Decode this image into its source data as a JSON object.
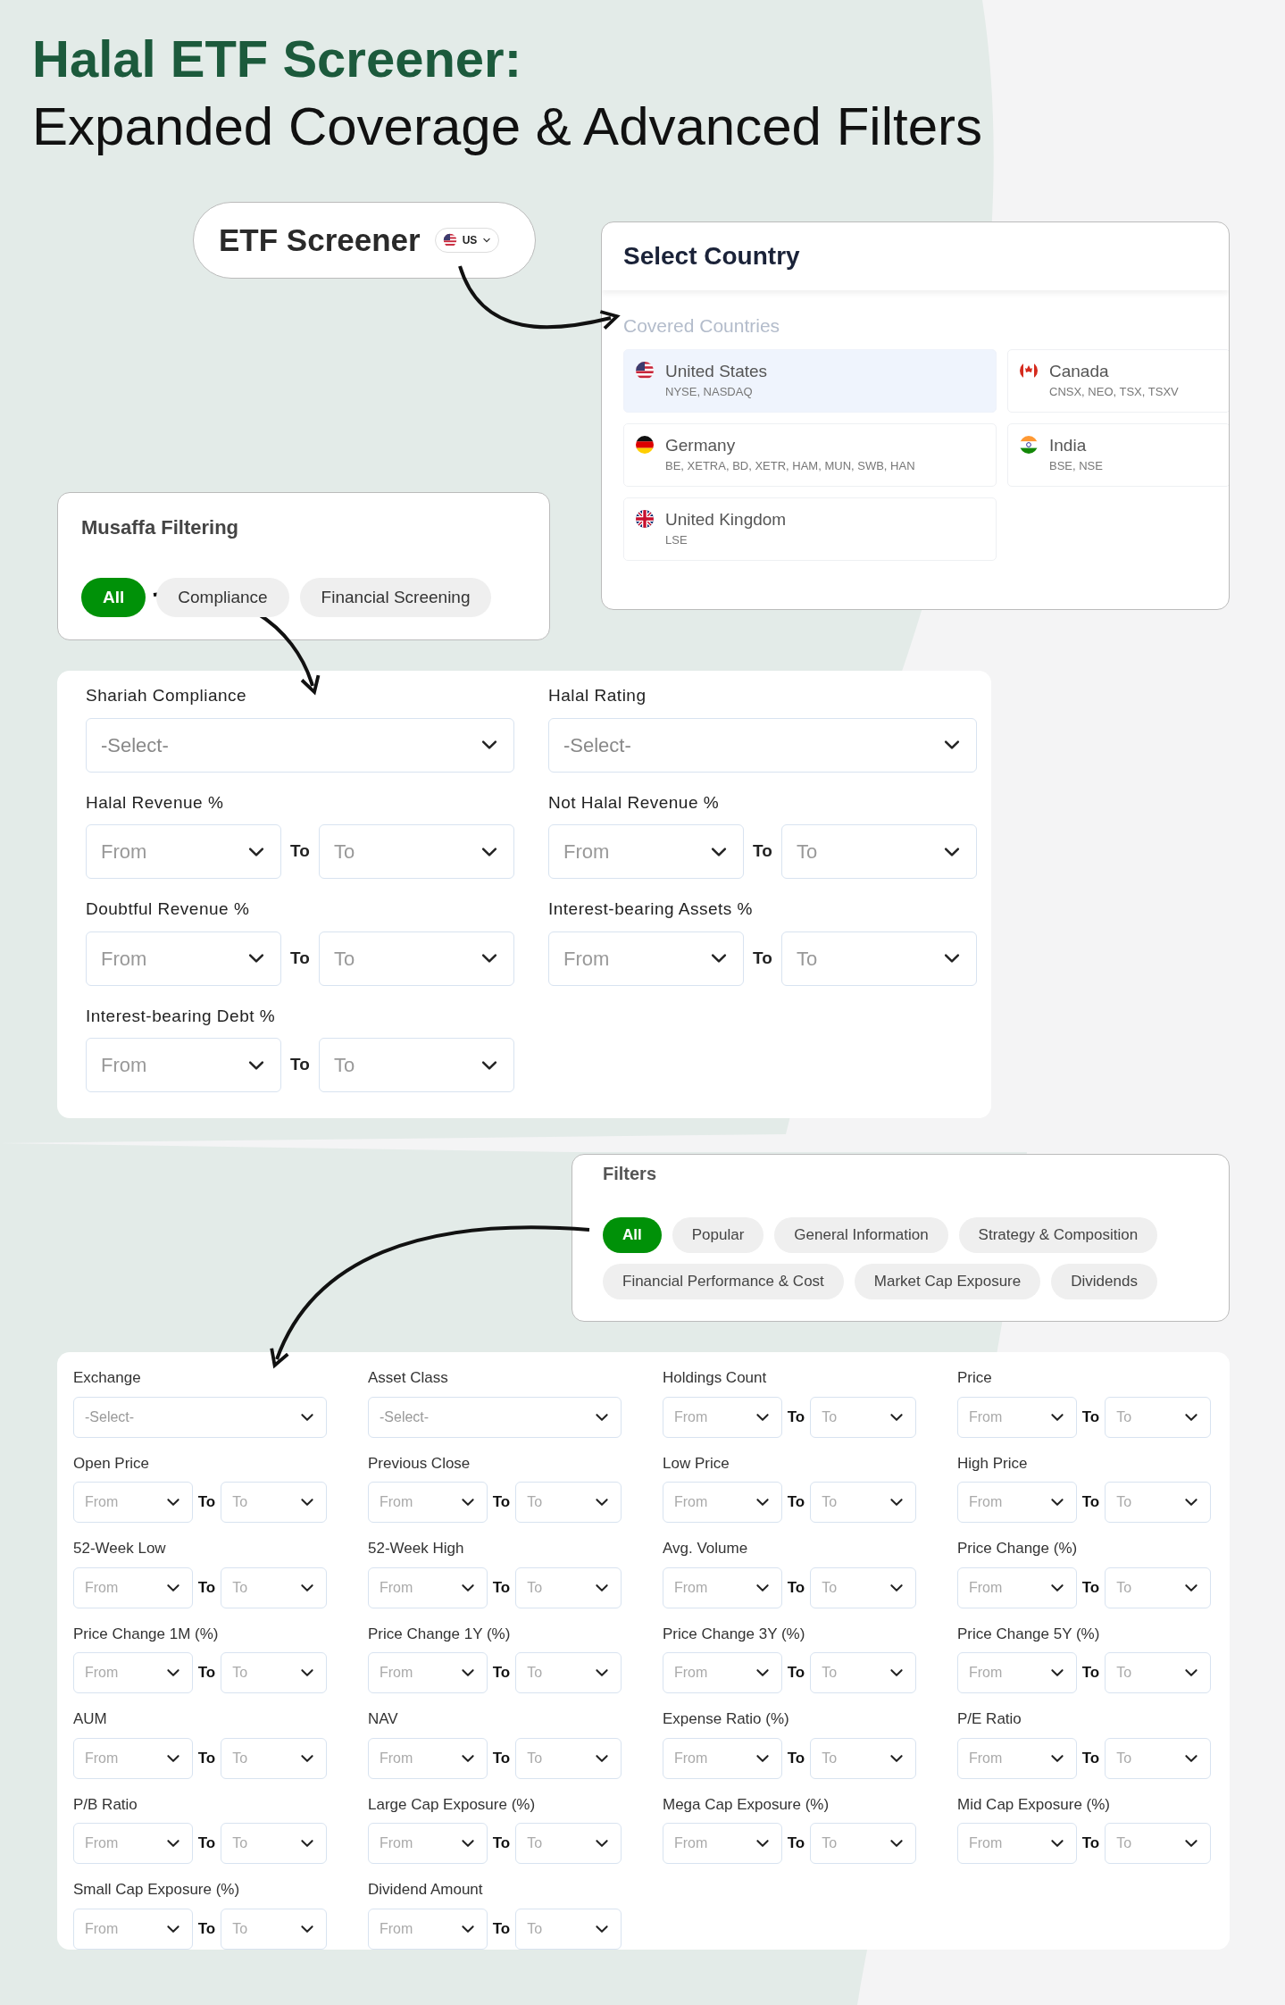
{
  "headline": {
    "title": "Halal ETF Screener:",
    "subtitle": "Expanded Coverage & Advanced Filters"
  },
  "etf_screener": {
    "title": "ETF Screener",
    "country_code": "US"
  },
  "select_country": {
    "title": "Select Country",
    "section": "Covered Countries",
    "countries": [
      {
        "name": "United States",
        "exchanges": "NYSE, NASDAQ",
        "kind": "us",
        "selected": true
      },
      {
        "name": "Canada",
        "exchanges": "CNSX, NEO, TSX, TSXV",
        "kind": "ca",
        "selected": false
      },
      {
        "name": "Germany",
        "exchanges": "BE, XETRA, BD, XETR, HAM, MUN, SWB, HAN",
        "kind": "de",
        "selected": false
      },
      {
        "name": "India",
        "exchanges": "BSE, NSE",
        "kind": "in",
        "selected": false
      },
      {
        "name": "United Kingdom",
        "exchanges": "LSE",
        "kind": "gb",
        "selected": false
      }
    ]
  },
  "musaffa_filtering": {
    "title": "Musaffa Filtering",
    "chips": [
      {
        "label": "All",
        "selected": true
      },
      {
        "label": "Compliance",
        "selected": false
      },
      {
        "label": "Financial Screening",
        "selected": false
      }
    ]
  },
  "shariah_filters": [
    {
      "label": "Shariah Compliance",
      "kind": "select",
      "placeholder": "-Select-"
    },
    {
      "label": "Halal Rating",
      "kind": "select",
      "placeholder": "-Select-"
    },
    {
      "label": "Halal Revenue %",
      "kind": "range",
      "from": "From",
      "separator": "To",
      "to": "To"
    },
    {
      "label": "Not Halal Revenue %",
      "kind": "range",
      "from": "From",
      "separator": "To",
      "to": "To"
    },
    {
      "label": "Doubtful Revenue %",
      "kind": "range",
      "from": "From",
      "separator": "To",
      "to": "To"
    },
    {
      "label": "Interest-bearing Assets %",
      "kind": "range",
      "from": "From",
      "separator": "To",
      "to": "To"
    },
    {
      "label": "Interest-bearing Debt %",
      "kind": "range",
      "from": "From",
      "separator": "To",
      "to": "To"
    }
  ],
  "filters": {
    "title": "Filters",
    "chips": [
      {
        "label": "All",
        "selected": true
      },
      {
        "label": "Popular",
        "selected": false
      },
      {
        "label": "General Information",
        "selected": false
      },
      {
        "label": "Strategy & Composition",
        "selected": false
      },
      {
        "label": "Financial Performance & Cost",
        "selected": false
      },
      {
        "label": "Market Cap Exposure",
        "selected": false
      },
      {
        "label": "Dividends",
        "selected": false
      }
    ]
  },
  "etf_filters": [
    {
      "label": "Exchange",
      "kind": "select",
      "placeholder": "-Select-"
    },
    {
      "label": "Asset Class",
      "kind": "select",
      "placeholder": "-Select-"
    },
    {
      "label": "Holdings Count",
      "kind": "range",
      "from": "From",
      "separator": "To",
      "to": "To"
    },
    {
      "label": "Price",
      "kind": "range",
      "from": "From",
      "separator": "To",
      "to": "To"
    },
    {
      "label": "Open Price",
      "kind": "range",
      "from": "From",
      "separator": "To",
      "to": "To"
    },
    {
      "label": "Previous Close",
      "kind": "range",
      "from": "From",
      "separator": "To",
      "to": "To"
    },
    {
      "label": "Low Price",
      "kind": "range",
      "from": "From",
      "separator": "To",
      "to": "To"
    },
    {
      "label": "High Price",
      "kind": "range",
      "from": "From",
      "separator": "To",
      "to": "To"
    },
    {
      "label": "52-Week Low",
      "kind": "range",
      "from": "From",
      "separator": "To",
      "to": "To"
    },
    {
      "label": "52-Week High",
      "kind": "range",
      "from": "From",
      "separator": "To",
      "to": "To"
    },
    {
      "label": "Avg. Volume",
      "kind": "range",
      "from": "From",
      "separator": "To",
      "to": "To"
    },
    {
      "label": "Price Change (%)",
      "kind": "range",
      "from": "From",
      "separator": "To",
      "to": "To"
    },
    {
      "label": "Price Change 1M (%)",
      "kind": "range",
      "from": "From",
      "separator": "To",
      "to": "To"
    },
    {
      "label": "Price Change 1Y (%)",
      "kind": "range",
      "from": "From",
      "separator": "To",
      "to": "To"
    },
    {
      "label": "Price Change 3Y (%)",
      "kind": "range",
      "from": "From",
      "separator": "To",
      "to": "To"
    },
    {
      "label": "Price Change 5Y (%)",
      "kind": "range",
      "from": "From",
      "separator": "To",
      "to": "To"
    },
    {
      "label": "AUM",
      "kind": "range",
      "from": "From",
      "separator": "To",
      "to": "To"
    },
    {
      "label": "NAV",
      "kind": "range",
      "from": "From",
      "separator": "To",
      "to": "To"
    },
    {
      "label": "Expense Ratio (%)",
      "kind": "range",
      "from": "From",
      "separator": "To",
      "to": "To"
    },
    {
      "label": "P/E Ratio",
      "kind": "range",
      "from": "From",
      "separator": "To",
      "to": "To"
    },
    {
      "label": "P/B Ratio",
      "kind": "range",
      "from": "From",
      "separator": "To",
      "to": "To"
    },
    {
      "label": "Large Cap Exposure (%)",
      "kind": "range",
      "from": "From",
      "separator": "To",
      "to": "To"
    },
    {
      "label": "Mega Cap Exposure (%)",
      "kind": "range",
      "from": "From",
      "separator": "To",
      "to": "To"
    },
    {
      "label": "Mid Cap Exposure (%)",
      "kind": "range",
      "from": "From",
      "separator": "To",
      "to": "To"
    },
    {
      "label": "Small Cap Exposure (%)",
      "kind": "range",
      "from": "From",
      "separator": "To",
      "to": "To"
    },
    {
      "label": "Dividend Amount",
      "kind": "range",
      "from": "From",
      "separator": "To",
      "to": "To"
    }
  ]
}
